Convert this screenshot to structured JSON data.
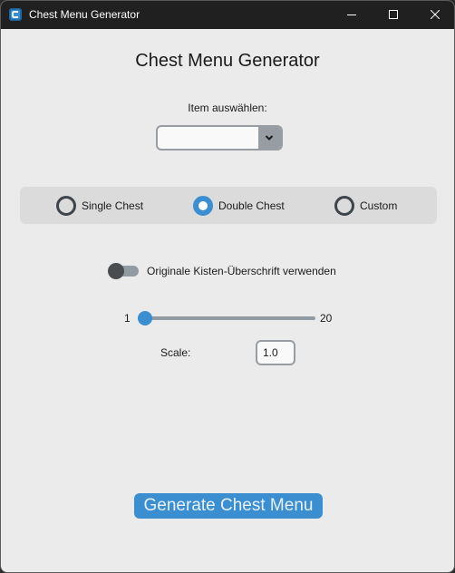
{
  "window": {
    "title": "Chest Menu Generator",
    "icon": "app-icon",
    "controls": [
      "minimize-icon",
      "maximize-icon",
      "close-icon"
    ]
  },
  "main": {
    "heading": "Chest Menu Generator",
    "item_select": {
      "label": "Item auswählen:",
      "value": ""
    },
    "chest_type": {
      "options": [
        "Single Chest",
        "Double Chest",
        "Custom"
      ],
      "selected": "Double Chest"
    },
    "title_toggle": {
      "label": "Originale Kisten-Überschrift verwenden",
      "on": false
    },
    "slider": {
      "min_label": "1",
      "max_label": "20",
      "min": 1,
      "max": 20,
      "value": 1
    },
    "scale": {
      "label": "Scale:",
      "value": "1.0"
    },
    "generate_button": "Generate Chest Menu"
  },
  "colors": {
    "accent": "#3b8ed0",
    "background": "#ebebeb",
    "titlebar": "#202020",
    "frame": "#dbdbdb",
    "border": "#979da2"
  }
}
